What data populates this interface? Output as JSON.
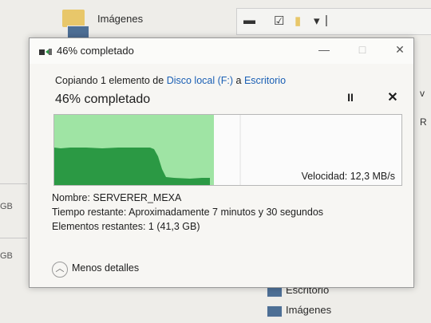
{
  "background": {
    "top_folder_label": "Imágenes",
    "bottom_folder_label": "Escritorio",
    "bottom_images_label": "Imágenes",
    "left_size_1": "GB",
    "left_size_2": "GB",
    "right_char_1": "v",
    "right_char_2": "r",
    "right_char_3": "R"
  },
  "dialog": {
    "title": "46% completado",
    "copy_prefix": "Copiando 1 elemento de ",
    "source": "Disco local (F:)",
    "copy_mid": " a ",
    "destination": "Escritorio",
    "status": "46% completado",
    "progress": 0.46,
    "speed_label": "Velocidad: 12,3 MB/s",
    "name_label": "Nombre:",
    "name_value": "SERVERER_MEXA",
    "time_label": "Tiempo restante:",
    "time_value": "Aproximadamente 7 minutos y 30 segundos",
    "items_label": "Elementos restantes:",
    "items_value": "1 (41,3 GB)",
    "less_details": "Menos detalles",
    "pause_icon": "pause-icon",
    "cancel_icon": "close-icon"
  },
  "colors": {
    "progress_fill": "#9fe4a4",
    "speed_fill": "#2b9944",
    "link": "#1a5fb4"
  }
}
